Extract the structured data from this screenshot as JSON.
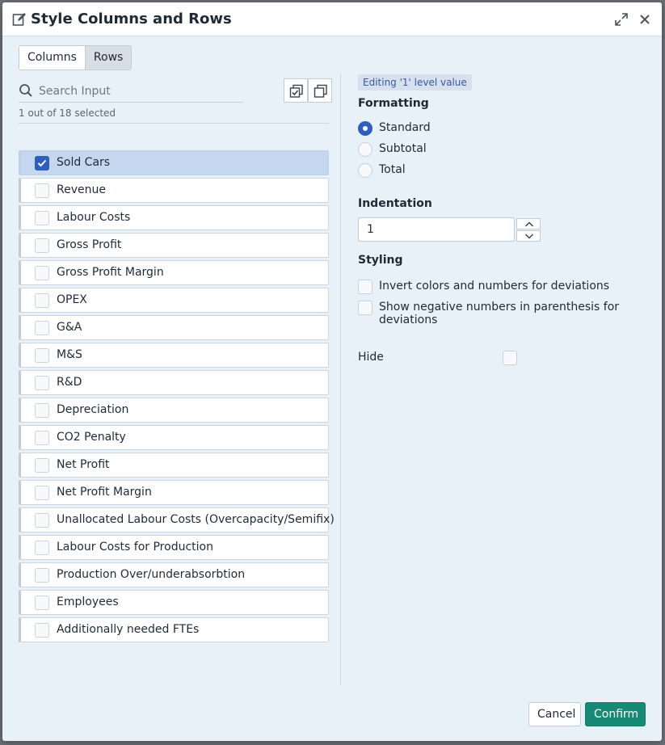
{
  "dialog": {
    "title": "Style Columns and Rows",
    "icons": {
      "title": "edit-icon",
      "expand": "expand-icon",
      "close": "close-icon"
    }
  },
  "tabs": [
    {
      "label": "Columns",
      "active": false
    },
    {
      "label": "Rows",
      "active": true
    }
  ],
  "search": {
    "placeholder": "Search Input",
    "value": ""
  },
  "selection": {
    "count_text": "1 out of 18 selected"
  },
  "rows": [
    {
      "label": "Sold Cars",
      "checked": true
    },
    {
      "label": "Revenue",
      "checked": false
    },
    {
      "label": "Labour Costs",
      "checked": false
    },
    {
      "label": "Gross Profit",
      "checked": false
    },
    {
      "label": "Gross Profit Margin",
      "checked": false
    },
    {
      "label": "OPEX",
      "checked": false
    },
    {
      "label": "G&A",
      "checked": false
    },
    {
      "label": "M&S",
      "checked": false
    },
    {
      "label": "R&D",
      "checked": false
    },
    {
      "label": "Depreciation",
      "checked": false
    },
    {
      "label": "CO2 Penalty",
      "checked": false
    },
    {
      "label": "Net Profit",
      "checked": false
    },
    {
      "label": "Net Profit Margin",
      "checked": false
    },
    {
      "label": "Unallocated Labour Costs (Overcapacity/Semifix)",
      "checked": false
    },
    {
      "label": "Labour Costs for Production",
      "checked": false
    },
    {
      "label": "Production Over/underabsorbtion",
      "checked": false
    },
    {
      "label": "Employees",
      "checked": false
    },
    {
      "label": "Additionally needed FTEs",
      "checked": false
    }
  ],
  "editor": {
    "badge": "Editing '1' level value",
    "formatting": {
      "title": "Formatting",
      "options": [
        "Standard",
        "Subtotal",
        "Total"
      ],
      "selected": "Standard"
    },
    "indentation": {
      "title": "Indentation",
      "value": "1"
    },
    "styling": {
      "title": "Styling",
      "invert_label": "Invert colors and numbers for deviations",
      "negative_label": "Show negative numbers in parenthesis for deviations"
    },
    "hide": {
      "label": "Hide",
      "checked": false
    }
  },
  "footer": {
    "cancel_label": "Cancel",
    "confirm_label": "Confirm"
  },
  "colors": {
    "accent": "#2e5fbf",
    "confirm": "#178a76",
    "selected_row": "#c5d7ef"
  }
}
